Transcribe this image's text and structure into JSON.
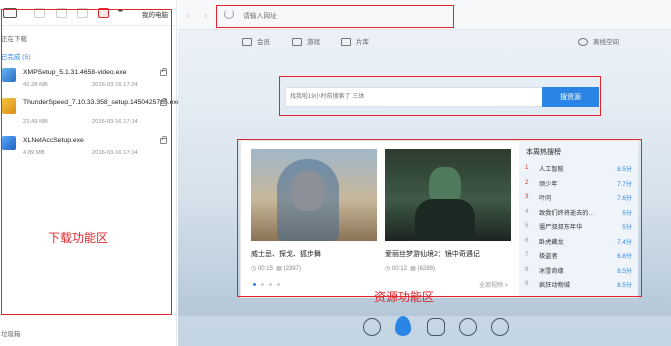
{
  "download_panel": {
    "toolbar_right_label": "我的电脑",
    "more_glyph": "•••",
    "section_downloading": "正在下载",
    "section_completed": "已完成 (5)",
    "items": [
      {
        "name": "XMPSetup_5.1.31.4658-video.exe",
        "size": "42.28 MB",
        "date": "2016-03-16 17:24",
        "icon": "xmp-icon"
      },
      {
        "name": "ThunderSpeed_7.10.33.358_setup.1450425785.exe",
        "size": "23.49 MB",
        "date": "2016-03-16 17:14",
        "icon": "thunder-icon"
      },
      {
        "name": "XLNetAccSetup.exe",
        "size": "4.89 MB",
        "date": "2016-03-16 17:14",
        "icon": "xlnetacc-icon"
      }
    ],
    "annotation": "下载功能区",
    "footer_label": "垃圾箱"
  },
  "browser": {
    "address_placeholder": "请输入网址",
    "nav_links": [
      "会员",
      "游戏",
      "片库"
    ],
    "right_link": "离线空间",
    "search_placeholder": "找我啦19小时前搜索了 三体",
    "search_button": "搜资源",
    "annotation": "资源功能区",
    "cards": [
      {
        "title": "威士忌、探戈、狐步舞",
        "duration": "00:15",
        "count": "(2397)"
      },
      {
        "title": "爱丽丝梦游仙境2：镜中奇遇记",
        "duration": "00:12",
        "count": "(6288)"
      }
    ],
    "more_link": "全部视频 >",
    "hot_list": {
      "title": "本周热搜榜",
      "items": [
        {
          "rank": "1",
          "name": "人工智能",
          "score": "8.5分"
        },
        {
          "rank": "2",
          "name": "顽少年",
          "score": "7.7分"
        },
        {
          "rank": "3",
          "name": "叶问",
          "score": "7.6分"
        },
        {
          "rank": "4",
          "name": "致我们终将逝去的…",
          "score": "5分"
        },
        {
          "rank": "5",
          "name": "僵尸叔叔东年华",
          "score": "5分"
        },
        {
          "rank": "6",
          "name": "卧虎藏龙",
          "score": "7.4分"
        },
        {
          "rank": "7",
          "name": "极盗者",
          "score": "6.8分"
        },
        {
          "rank": "8",
          "name": "冰雪奇缘",
          "score": "8.5分"
        },
        {
          "rank": "9",
          "name": "疯狂动物城",
          "score": "8.5分"
        }
      ]
    }
  },
  "colors": {
    "accent": "#2a85e6",
    "annotation": "#e0262c"
  }
}
